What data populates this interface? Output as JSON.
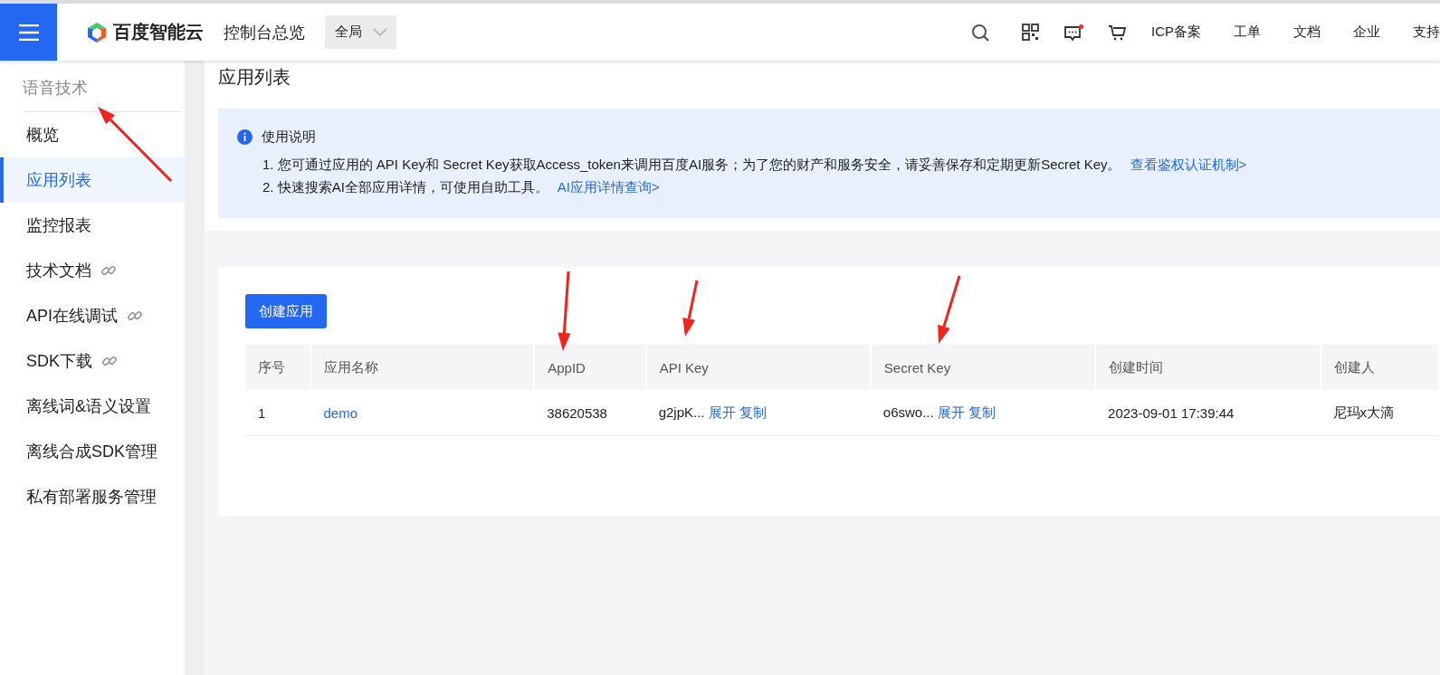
{
  "header": {
    "brand": "百度智能云",
    "title": "控制台总览",
    "scope": "全局",
    "links": [
      "ICP备案",
      "工单",
      "文档",
      "企业",
      "支持"
    ]
  },
  "sidebar": {
    "title": "语音技术",
    "items": [
      {
        "label": "概览",
        "selected": false,
        "external": false
      },
      {
        "label": "应用列表",
        "selected": true,
        "external": false
      },
      {
        "label": "监控报表",
        "selected": false,
        "external": false
      },
      {
        "label": "技术文档",
        "selected": false,
        "external": true
      },
      {
        "label": "API在线调试",
        "selected": false,
        "external": true
      },
      {
        "label": "SDK下载",
        "selected": false,
        "external": true
      },
      {
        "label": "离线词&语义设置",
        "selected": false,
        "external": false
      },
      {
        "label": "离线合成SDK管理",
        "selected": false,
        "external": false
      },
      {
        "label": "私有部署服务管理",
        "selected": false,
        "external": false
      }
    ]
  },
  "page": {
    "title": "应用列表",
    "notice": {
      "title": "使用说明",
      "lines": [
        {
          "text": "1. 您可通过应用的 API Key和 Secret Key获取Access_token来调用百度AI服务；为了您的财产和服务安全，请妥善保存和定期更新Secret Key。",
          "link": "查看鉴权认证机制>"
        },
        {
          "text": "2. 快速搜索AI全部应用详情，可使用自助工具。",
          "link": "AI应用详情查询>"
        }
      ]
    }
  },
  "create_button": "创建应用",
  "table": {
    "columns": [
      "序号",
      "应用名称",
      "AppID",
      "API Key",
      "Secret Key",
      "创建时间",
      "创建人"
    ],
    "rows": [
      {
        "index": "1",
        "name": "demo",
        "app_id": "38620538",
        "api_key": "g2jpK...",
        "api_key_actions": [
          "展开",
          "复制"
        ],
        "secret_key": "o6swo...",
        "secret_key_actions": [
          "展开",
          "复制"
        ],
        "created": "2023-09-01 17:39:44",
        "creator": "尼玛x大滴"
      }
    ]
  }
}
